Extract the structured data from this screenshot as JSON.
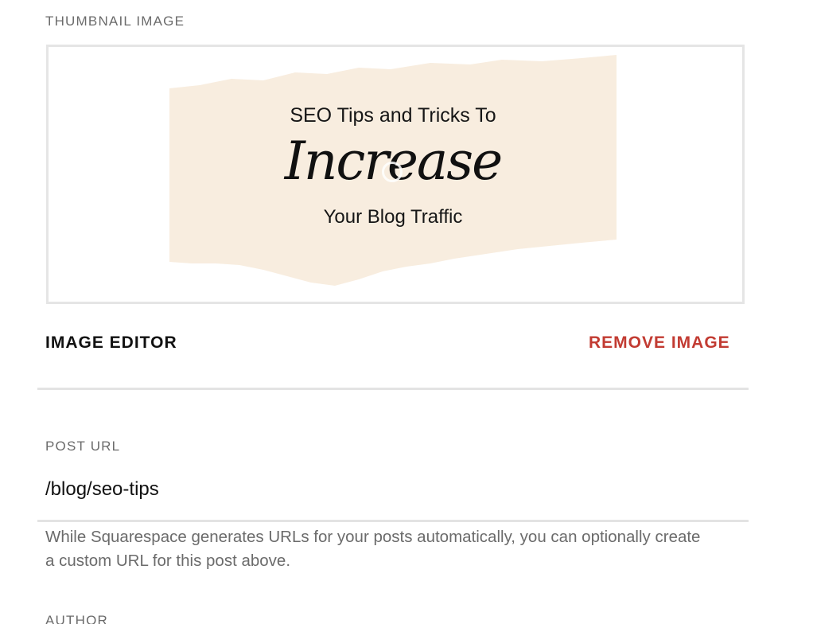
{
  "thumbnail": {
    "section_label": "THUMBNAIL IMAGE",
    "image_text": {
      "line1": "SEO Tips and Tricks To",
      "script": "Increase",
      "line3": "Your Blog Traffic"
    },
    "background_color": "#f8eddf",
    "image_editor_label": "IMAGE EDITOR",
    "remove_image_label": "REMOVE IMAGE"
  },
  "post_url": {
    "section_label": "POST URL",
    "value": "/blog/seo-tips",
    "help_text": "While Squarespace generates URLs for your posts automatically, you can optionally create a custom URL for this post above."
  },
  "author": {
    "section_label": "AUTHOR"
  },
  "colors": {
    "label": "#6b6b6b",
    "danger": "#c23b32",
    "divider": "#e3e3e3"
  }
}
